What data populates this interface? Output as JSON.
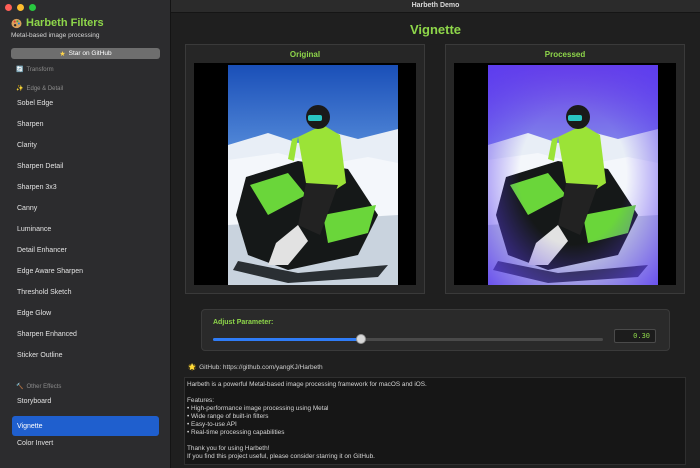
{
  "window": {
    "title": "Harbeth Demo"
  },
  "sidebar": {
    "app_name": "Harbeth Filters",
    "subtitle": "Metal-based image processing",
    "star_button": "Star on GitHub",
    "sections": [
      {
        "label": "Transform",
        "icon": "transform-icon"
      },
      {
        "label": "Edge & Detail",
        "icon": "sparkles-icon"
      },
      {
        "label": "Other Effects",
        "icon": "hammer-icon"
      }
    ],
    "items": [
      {
        "label": "Sobel Edge",
        "active": false
      },
      {
        "label": "Sharpen",
        "active": false
      },
      {
        "label": "Clarity",
        "active": false
      },
      {
        "label": "Sharpen Detail",
        "active": false
      },
      {
        "label": "Sharpen 3x3",
        "active": false
      },
      {
        "label": "Canny",
        "active": false
      },
      {
        "label": "Luminance",
        "active": false
      },
      {
        "label": "Detail Enhancer",
        "active": false
      },
      {
        "label": "Edge Aware Sharpen",
        "active": false
      },
      {
        "label": "Threshold Sketch",
        "active": false
      },
      {
        "label": "Edge Glow",
        "active": false
      },
      {
        "label": "Sharpen Enhanced",
        "active": false
      },
      {
        "label": "Sticker Outline",
        "active": false
      },
      {
        "label": "Storyboard",
        "active": false
      },
      {
        "label": "Vignette",
        "active": true
      },
      {
        "label": "Color Invert",
        "active": false
      }
    ]
  },
  "main": {
    "title": "Vignette",
    "original_label": "Original",
    "processed_label": "Processed",
    "parameter": {
      "label": "Adjust Parameter:",
      "value_text": "0.30",
      "fraction": 0.38
    },
    "github_text": "GitHub: https://github.com/yangKJ/Harbeth",
    "description": "Harbeth is a powerful Metal-based image processing framework for macOS and iOS.\n\nFeatures:\n• High-performance image processing using Metal\n• Wide range of built-in filters\n• Easy-to-use API\n• Real-time processing capabilities\n\nThank you for using Harbeth!\nIf you find this project useful, please consider starring it on GitHub."
  },
  "colors": {
    "accent_green": "#8ed64a",
    "selection_blue": "#1f5fce",
    "slider_blue": "#2f7cf6"
  }
}
